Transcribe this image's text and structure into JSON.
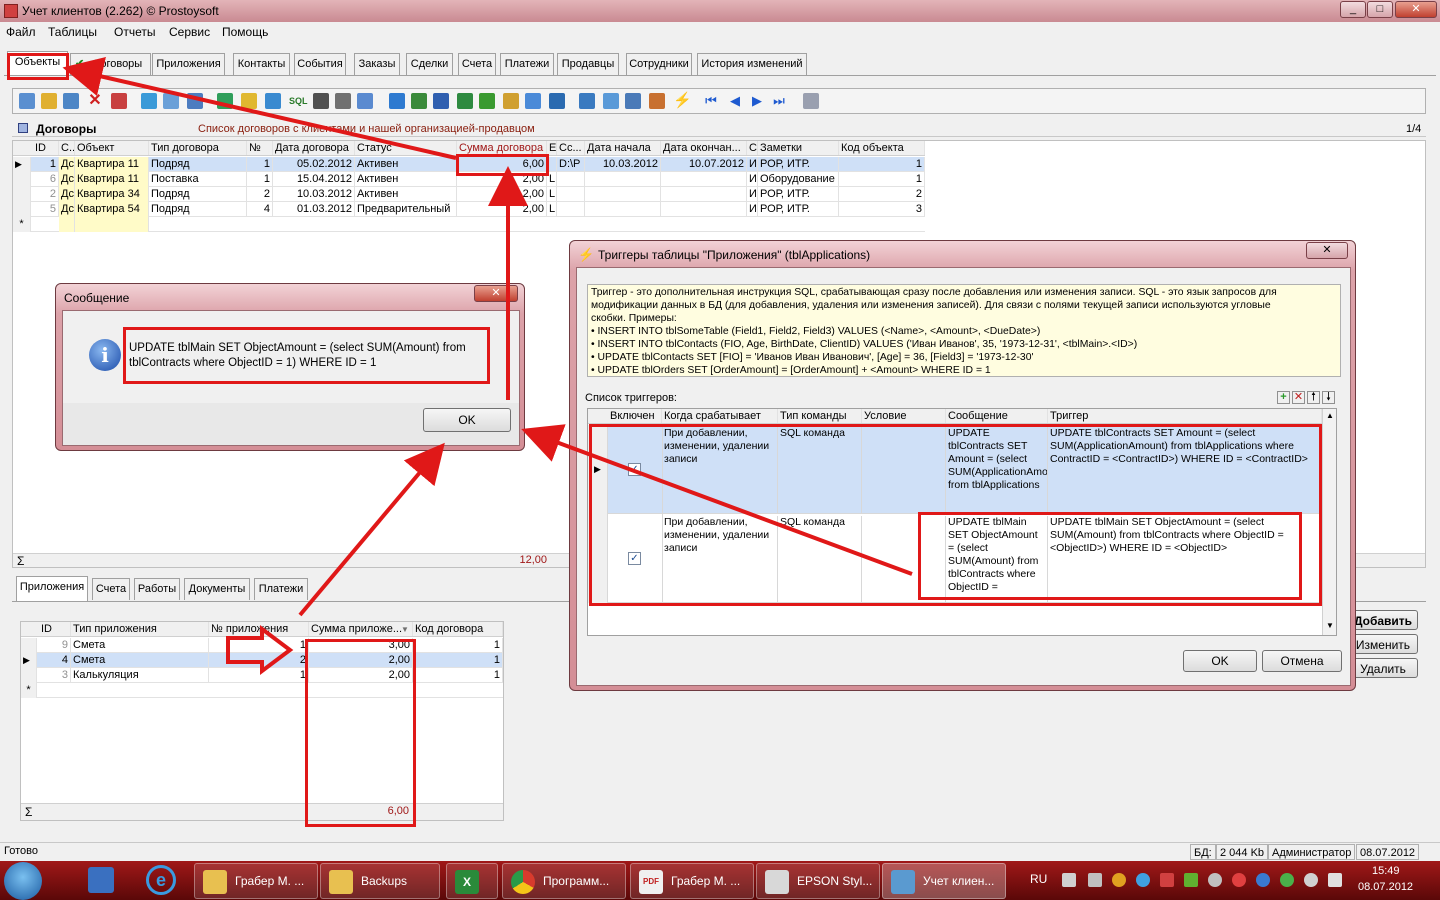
{
  "window": {
    "title": "Учет клиентов (2.262) © Prostoysoft"
  },
  "menu": [
    "Файл",
    "Таблицы",
    "Отчеты",
    "Сервис",
    "Помощь"
  ],
  "tabs": [
    "Объекты",
    "Договоры",
    "Приложения",
    "Контакты",
    "События",
    "Заказы",
    "Сделки",
    "Счета",
    "Платежи",
    "Продавцы",
    "Сотрудники",
    "История изменений"
  ],
  "section": {
    "title": "Договоры",
    "subtitle": "Список договоров с клиентами и нашей организацией-продавцом",
    "page": "1/4"
  },
  "contracts": {
    "columns": [
      "ID",
      "С..",
      "Объект",
      "Тип договора",
      "№",
      "Дата договора",
      "Статус",
      "Сумма договора",
      "E",
      "Сс...",
      "Дата начала",
      "Дата окончан...",
      "С",
      "Заметки",
      "Код объекта"
    ],
    "rows": [
      [
        "1",
        "Дс",
        "Квартира 11",
        "Подряд",
        "1",
        "05.02.2012",
        "Активен",
        "6,00",
        "",
        "D:\\P",
        "10.03.2012",
        "10.07.2012",
        "И",
        "РОР, ИТР.",
        "1"
      ],
      [
        "6",
        "Дс",
        "Квартира 11",
        "Поставка",
        "1",
        "15.04.2012",
        "Активен",
        "2,00",
        "L",
        "",
        "",
        "",
        "И",
        "Оборудование",
        "1"
      ],
      [
        "2",
        "Дс",
        "Квартира 34",
        "Подряд",
        "2",
        "10.03.2012",
        "Активен",
        "2,00",
        "L",
        "",
        "",
        "",
        "И",
        "РОР, ИТР.",
        "2"
      ],
      [
        "5",
        "Дс",
        "Квартира 54",
        "Подряд",
        "4",
        "01.03.2012",
        "Предварительный",
        "2,00",
        "L",
        "",
        "",
        "",
        "И",
        "РОР, ИТР.",
        "3"
      ]
    ],
    "total": "12,00"
  },
  "bottom_tabs": [
    "Приложения",
    "Счета",
    "Работы",
    "Документы",
    "Платежи"
  ],
  "apps": {
    "columns": [
      "ID",
      "Тип приложения",
      "№ приложения",
      "Сумма приложе...",
      "Код договора"
    ],
    "rows": [
      [
        "9",
        "Смета",
        "1",
        "3,00",
        "1"
      ],
      [
        "4",
        "Смета",
        "2",
        "2,00",
        "1"
      ],
      [
        "3",
        "Калькуляция",
        "1",
        "2,00",
        "1"
      ]
    ],
    "total": "6,00"
  },
  "message": {
    "title": "Сообщение",
    "text": "UPDATE tblMain SET ObjectAmount = (select SUM(Amount) from tblContracts where ObjectID = 1) WHERE ID = 1",
    "ok": "OK"
  },
  "trigger_dialog": {
    "title": "Триггеры таблицы \"Приложения\" (tblApplications)",
    "help_lines": [
      "Триггер - это дополнительная инструкция SQL, срабатывающая сразу после добавления или изменения записи. SQL - это язык запросов для",
      "модификации данных в БД (для добавления, удаления или изменения записей). Для связи с полями текущей записи используются угловые",
      "скобки. Примеры:",
      "• INSERT INTO tblSomeTable (Field1, Field2, Field3) VALUES (<Name>, <Amount>, <DueDate>)",
      "• INSERT INTO tblContacts (FIO, Age, BirthDate, ClientID) VALUES ('Иван Иванов', 35, '1973-12-31', <tblMain>.<ID>)",
      "• UPDATE tblContacts SET [FIO] = 'Иванов Иван Иванович', [Age] = 36, [Field3] = '1973-12-30'",
      "• UPDATE tblOrders SET [OrderAmount] = [OrderAmount] + <Amount> WHERE ID = 1"
    ],
    "list_label": "Список триггеров:",
    "columns": [
      "Включен",
      "Когда срабатывает",
      "Тип команды",
      "Условие",
      "Сообщение",
      "Триггер"
    ],
    "rows": [
      {
        "when": "При добавлении, изменении, удалении записи",
        "type": "SQL команда",
        "cond": "",
        "msg": "UPDATE tblContracts SET Amount = (select SUM(ApplicationAmount) from tblApplications",
        "trigger": "UPDATE tblContracts SET Amount = (select SUM(ApplicationAmount) from tblApplications where ContractID = <ContractID>) WHERE ID = <ContractID>"
      },
      {
        "when": "При добавлении, изменении, удалении записи",
        "type": "SQL команда",
        "cond": "",
        "msg": "UPDATE tblMain SET ObjectAmount = (select SUM(Amount) from tblContracts where ObjectID =",
        "trigger": "UPDATE tblMain SET ObjectAmount = (select SUM(Amount) from tblContracts where ObjectID = <ObjectID>) WHERE ID = <ObjectID>"
      }
    ],
    "ok": "OK",
    "cancel": "Отмена"
  },
  "side_buttons": [
    "Добавить",
    "Изменить",
    "Удалить"
  ],
  "status": {
    "left": "Готово",
    "db_label": "БД:",
    "db_size": "2 044 Kb",
    "user": "Администратор",
    "date": "08.07.2012"
  },
  "taskbar": {
    "items": [
      "Грабер М. ...",
      "Backups",
      "",
      "Программ...",
      "Грабер М. ...",
      "EPSON Styl...",
      "Учет клиен..."
    ],
    "lang": "RU",
    "time": "15:49",
    "date": "08.07.2012"
  }
}
